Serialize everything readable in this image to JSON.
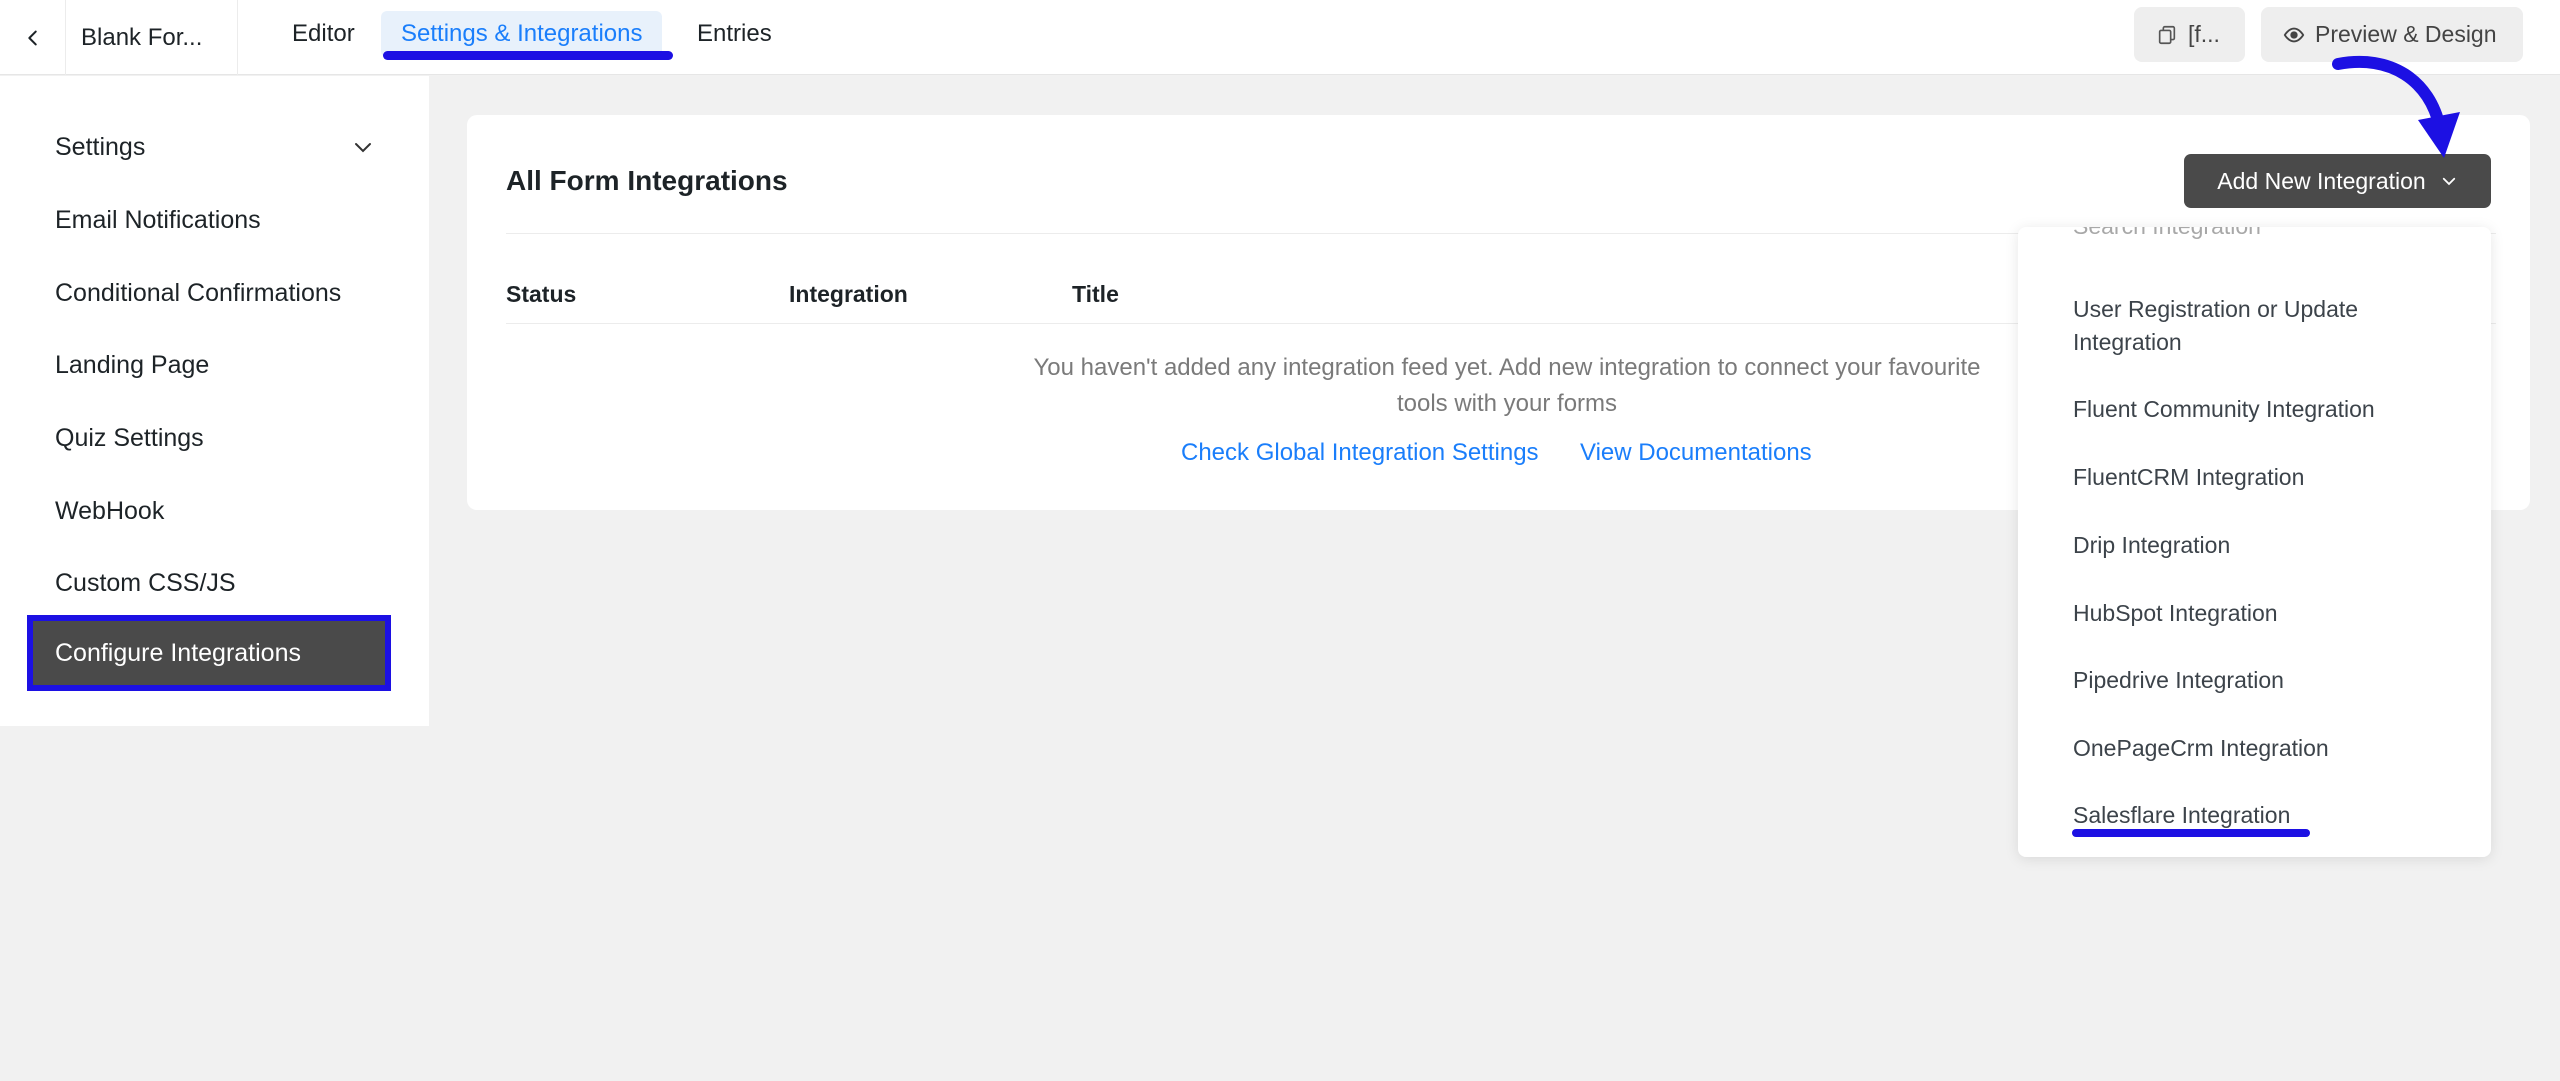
{
  "topbar": {
    "form_title": "Blank For...",
    "tabs": [
      {
        "label": "Editor"
      },
      {
        "label": "Settings & Integrations"
      },
      {
        "label": "Entries"
      }
    ],
    "shortcode_label": "[f...",
    "preview_label": "Preview & Design"
  },
  "sidebar": {
    "items": [
      {
        "label": "Settings"
      },
      {
        "label": "Email Notifications"
      },
      {
        "label": "Conditional Confirmations"
      },
      {
        "label": "Landing Page"
      },
      {
        "label": "Quiz Settings"
      },
      {
        "label": "WebHook"
      },
      {
        "label": "Custom CSS/JS"
      },
      {
        "label": "Configure Integrations"
      }
    ]
  },
  "main": {
    "title": "All Form Integrations",
    "add_button_label": "Add New Integration",
    "columns": [
      "Status",
      "Integration",
      "Title"
    ],
    "empty_message": "You haven't added any integration feed yet. Add new integration to connect your favourite tools with your forms",
    "links": {
      "global": "Check Global Integration Settings",
      "docs": "View Documentations"
    }
  },
  "dropdown": {
    "search_placeholder": "Search Integration",
    "items": [
      {
        "label": "User Registration or Update Integration"
      },
      {
        "label": "Fluent Community Integration"
      },
      {
        "label": "FluentCRM Integration"
      },
      {
        "label": "Drip Integration"
      },
      {
        "label": "HubSpot Integration"
      },
      {
        "label": "Pipedrive Integration"
      },
      {
        "label": "OnePageCrm Integration"
      },
      {
        "label": "Salesflare Integration"
      }
    ]
  },
  "colors": {
    "accent": "#1a7efb",
    "annotation": "#1c10e3",
    "active_bg": "#4a4a4a"
  }
}
